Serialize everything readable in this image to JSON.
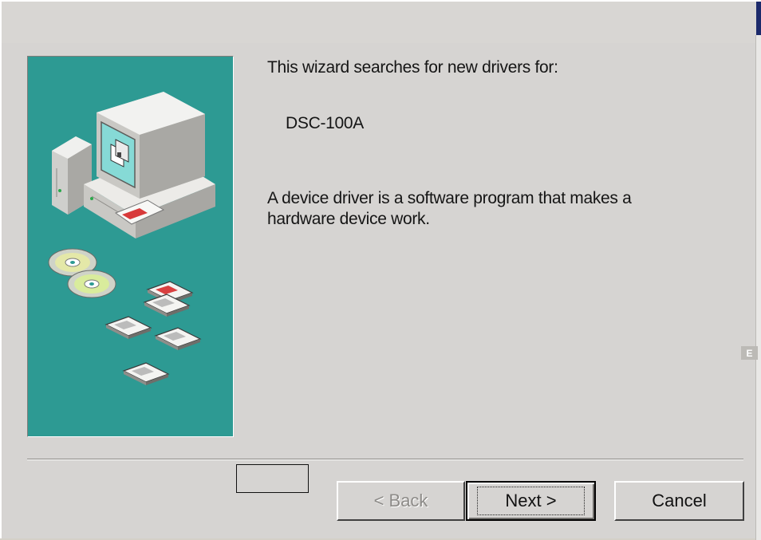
{
  "wizard": {
    "intro": "This wizard searches for new drivers for:",
    "device_name": "DSC-100A",
    "description_line1": "A device driver is a software program that makes a",
    "description_line2": "hardware device work."
  },
  "buttons": {
    "back_label": "< Back",
    "next_label": "Next >",
    "cancel_label": "Cancel"
  },
  "side_tab": {
    "label": "E"
  },
  "illustration": {
    "icons": [
      "computer-icon",
      "cd-rom-icon",
      "floppy-disk-icon"
    ]
  },
  "colors": {
    "panel": "#2d9a93",
    "dialog": "#d6d4d2",
    "title_accent": "#1c2a6b"
  }
}
